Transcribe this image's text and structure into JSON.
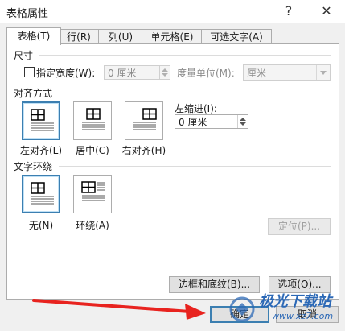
{
  "window": {
    "title": "表格属性",
    "help_glyph": "?",
    "close_glyph": "✕"
  },
  "tabs": [
    {
      "label": "表格(T)",
      "active": true
    },
    {
      "label": "行(R)",
      "active": false
    },
    {
      "label": "列(U)",
      "active": false
    },
    {
      "label": "单元格(E)",
      "active": false
    },
    {
      "label": "可选文字(A)",
      "active": false
    }
  ],
  "size": {
    "section_label": "尺寸",
    "preferred_width_label": "指定宽度(W):",
    "preferred_width_checked": false,
    "preferred_width_value": "0 厘米",
    "measure_in_label": "度量单位(M):",
    "measure_in_value": "厘米"
  },
  "alignment": {
    "section_label": "对齐方式",
    "options": [
      {
        "label": "左对齐(L)",
        "selected": true
      },
      {
        "label": "居中(C)",
        "selected": false
      },
      {
        "label": "右对齐(H)",
        "selected": false
      }
    ],
    "indent_label": "左缩进(I):",
    "indent_value": "0 厘米"
  },
  "text_wrapping": {
    "section_label": "文字环绕",
    "options": [
      {
        "label": "无(N)",
        "selected": true
      },
      {
        "label": "环绕(A)",
        "selected": false
      }
    ],
    "positioning_button": "定位(P)..."
  },
  "panel_buttons": {
    "borders_shading": "边框和底纹(B)...",
    "options": "选项(O)..."
  },
  "footer": {
    "ok": "确定",
    "cancel": "取消"
  },
  "watermark": {
    "text": "极光下载站",
    "sub": "www.xz7.com"
  },
  "colors": {
    "selection_border": "#3c7fb1",
    "annotation_arrow": "#e8231f",
    "watermark": "#2b68b6"
  }
}
